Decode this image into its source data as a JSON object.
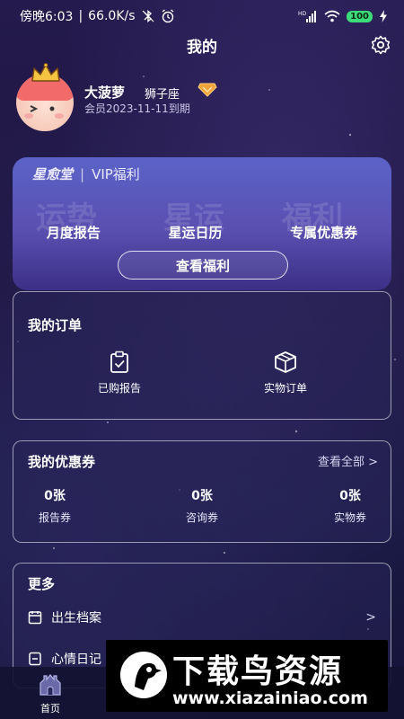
{
  "status_bar": {
    "time_text": "傍晚6:03",
    "speed_text": "66.0K/s",
    "battery_text": "100"
  },
  "header": {
    "title": "我的"
  },
  "profile": {
    "name": "大菠萝",
    "zodiac": "狮子座",
    "member_expiry": "会员2023-11-11到期"
  },
  "vip_card": {
    "brand": "星愈堂",
    "title": "VIP福利",
    "watermark": [
      "运势",
      "星运",
      "福利"
    ],
    "features": [
      "月度报告",
      "星运日历",
      "专属优惠券"
    ],
    "button_label": "查看福利"
  },
  "orders": {
    "title": "我的订单",
    "items": [
      {
        "label": "已购报告",
        "icon": "clipboard-check-icon"
      },
      {
        "label": "实物订单",
        "icon": "package-box-icon"
      }
    ]
  },
  "coupons": {
    "title": "我的优惠券",
    "see_all": "查看全部 >",
    "items": [
      {
        "count": "0张",
        "label": "报告券"
      },
      {
        "count": "0张",
        "label": "咨询券"
      },
      {
        "count": "0张",
        "label": "实物券"
      }
    ]
  },
  "more": {
    "title": "更多",
    "items": [
      {
        "label": "出生档案",
        "icon": "birth-record-icon",
        "chevron": ">"
      },
      {
        "label": "心情日记",
        "icon": "mood-diary-icon"
      }
    ]
  },
  "tabbar": {
    "home_label": "首页"
  },
  "watermark": {
    "title": "下载鸟资源",
    "url": "www.xiazainiao.com"
  },
  "colors": {
    "background": "#1d1640",
    "vip_card_top": "#5b63c8",
    "vip_card_bottom": "#3b2f86",
    "battery": "#3ddc7a",
    "crown": "#f5c542",
    "vip_badge": "#f0a33a"
  }
}
